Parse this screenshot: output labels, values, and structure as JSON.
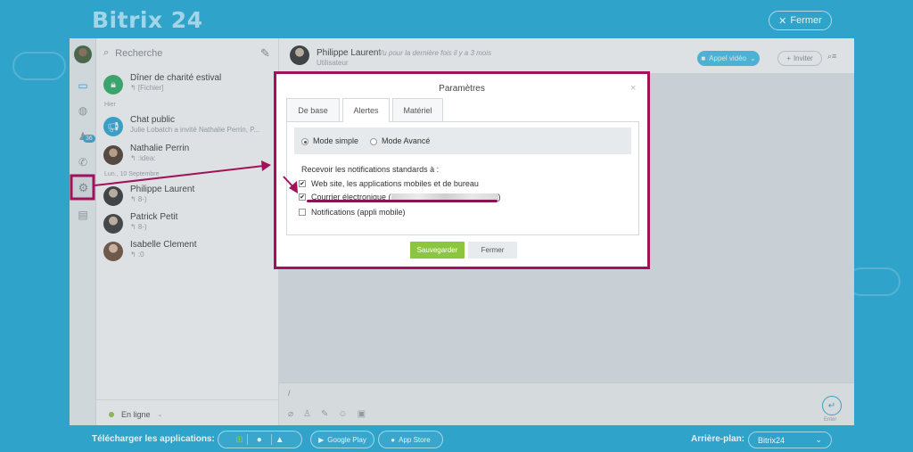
{
  "app": {
    "brand": "Bitrix 24",
    "close_label": "Fermer"
  },
  "sidebar": {
    "search_placeholder": "Recherche",
    "rail_badge": "36",
    "chats": [
      {
        "name": "Dîner de charité estival",
        "sub": "↰ [Fichier]"
      },
      {
        "name": "Chat public",
        "sub": "Julie Lobatch a invité Nathalie Perrin, P..."
      },
      {
        "name": "Nathalie Perrin",
        "sub": "↰ :idea:"
      },
      {
        "name": "Philippe Laurent",
        "sub": "↰ 8-)"
      },
      {
        "name": "Patrick Petit",
        "sub": "↰ 8-)"
      },
      {
        "name": "Isabelle Clement",
        "sub": "↰ :0"
      }
    ],
    "date_yesterday": "Hier",
    "date_sep": "Lun., 10 Septembre",
    "status": "En ligne"
  },
  "chat": {
    "name": "Philippe Laurent",
    "last_seen": "Vu pour la dernière fois il y a 3 mois",
    "role": "Utilisateur",
    "video_button": "Appel vidéo",
    "invite_button": "Inviter",
    "input_cursor": "/",
    "send_label": "Enter"
  },
  "modal": {
    "title": "Paramètres",
    "tabs": [
      "De base",
      "Alertes",
      "Matériel"
    ],
    "mode_simple": "Mode simple",
    "mode_advanced": "Mode Avancé",
    "receive_label": "Recevoir les notifications standards à :",
    "options": [
      {
        "label": "Web site, les applications mobiles et de bureau",
        "checked": true
      },
      {
        "label_prefix": "Courrier électronique (",
        "label_suffix": ")",
        "checked": true
      },
      {
        "label": "Notifications (appli mobile)",
        "checked": false
      }
    ],
    "save": "Sauvegarder",
    "close": "Fermer"
  },
  "footer": {
    "download_label": "Télécharger les applications:",
    "google_play": "Google Play",
    "app_store": "App Store",
    "background_label": "Arrière-plan:",
    "background_value": "Bitrix24"
  },
  "colors": {
    "accent": "#27a6d6",
    "annotation": "#a0135b",
    "save": "#8cc63f",
    "page_bg": "#2fa3c9"
  }
}
